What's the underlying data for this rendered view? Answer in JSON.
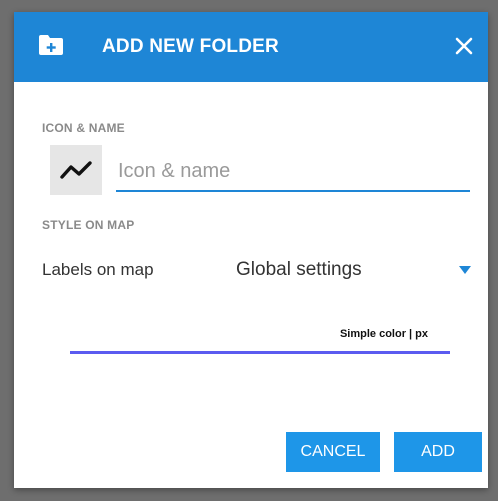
{
  "dialog": {
    "title": "ADD NEW FOLDER"
  },
  "icon_name": {
    "section_label": "ICON & NAME",
    "input_placeholder": "Icon & name",
    "input_value": "",
    "icon": "track-line-icon"
  },
  "style_on_map": {
    "section_label": "STYLE ON MAP",
    "labels_label": "Labels on map",
    "labels_value": "Global settings",
    "line_caption": "Simple color | px",
    "line_color": "#5b5bf0"
  },
  "actions": {
    "cancel_label": "CANCEL",
    "add_label": "ADD"
  },
  "colors": {
    "header": "#1e86d6",
    "button": "#1e96e8",
    "accent": "#1e86d6"
  }
}
